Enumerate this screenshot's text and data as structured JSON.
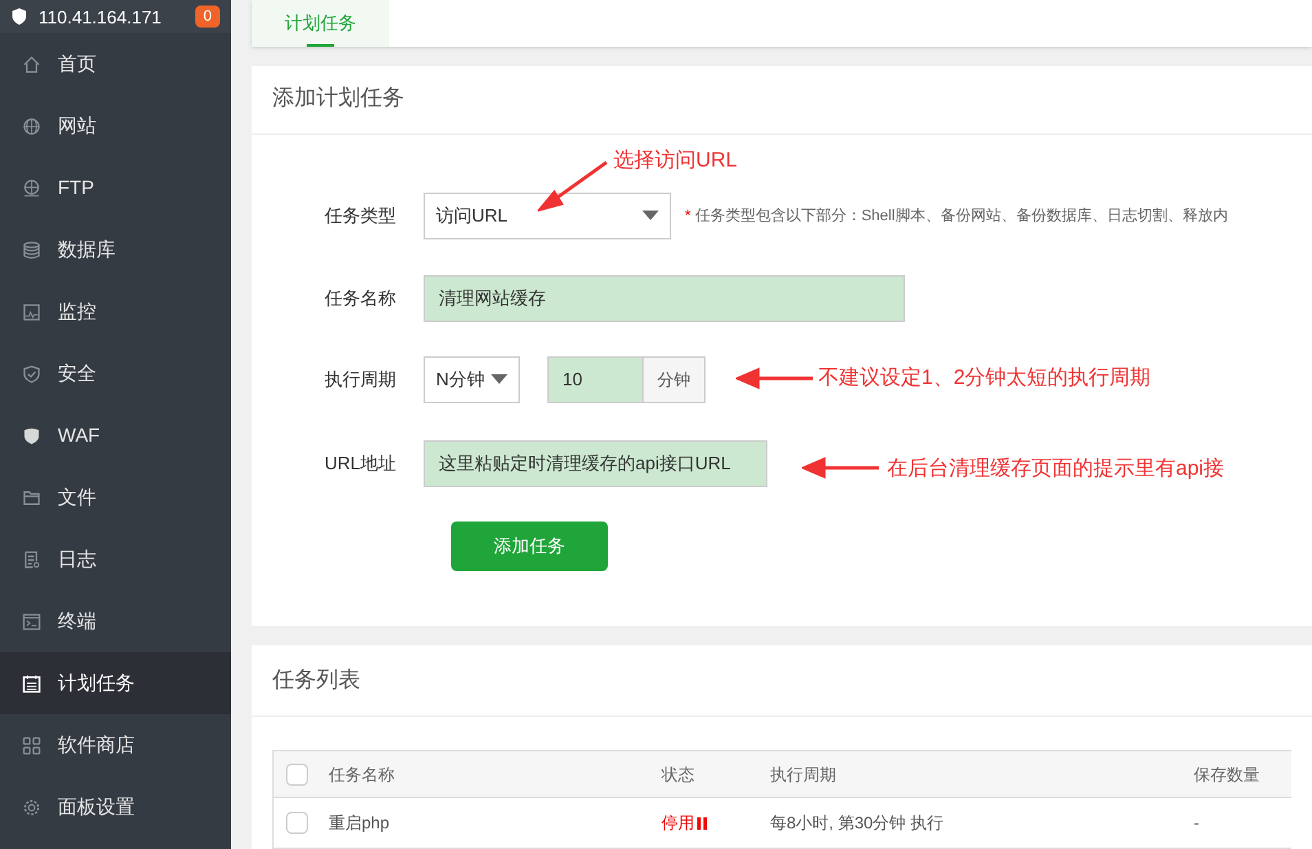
{
  "sidebar": {
    "host": "110.41.164.171",
    "badge": "0",
    "items": [
      {
        "label": "首页",
        "selected": false
      },
      {
        "label": "网站",
        "selected": false
      },
      {
        "label": "FTP",
        "selected": false
      },
      {
        "label": "数据库",
        "selected": false
      },
      {
        "label": "监控",
        "selected": false
      },
      {
        "label": "安全",
        "selected": false
      },
      {
        "label": "WAF",
        "selected": false
      },
      {
        "label": "文件",
        "selected": false
      },
      {
        "label": "日志",
        "selected": false
      },
      {
        "label": "终端",
        "selected": false
      },
      {
        "label": "计划任务",
        "selected": true
      },
      {
        "label": "软件商店",
        "selected": false
      },
      {
        "label": "面板设置",
        "selected": false
      }
    ]
  },
  "tabs": [
    {
      "label": "计划任务",
      "selected": true
    }
  ],
  "form": {
    "title": "添加计划任务",
    "task_type": {
      "label": "任务类型",
      "value": "访问URL",
      "note_mark": "*",
      "note": "任务类型包含以下部分：Shell脚本、备份网站、备份数据库、日志切割、释放内"
    },
    "task_name": {
      "label": "任务名称",
      "value": "清理网站缓存"
    },
    "period": {
      "label": "执行周期",
      "select": "N分钟",
      "value": "10",
      "unit": "分钟"
    },
    "url": {
      "label": "URL地址",
      "value": "这里粘贴定时清理缓存的api接口URL"
    },
    "submit": "添加任务"
  },
  "annotations": [
    "选择访问URL",
    "不建议设定1、2分钟太短的执行周期",
    "在后台清理缓存页面的提示里有api接"
  ],
  "table": {
    "title": "任务列表",
    "select_all_checked": false,
    "columns": [
      "任务名称",
      "状态",
      "执行周期",
      "保存数量"
    ],
    "rows": [
      {
        "checked": false,
        "name": "重启php",
        "status": "停用",
        "period": "每8小时, 第30分钟 执行",
        "count": "-"
      }
    ]
  }
}
